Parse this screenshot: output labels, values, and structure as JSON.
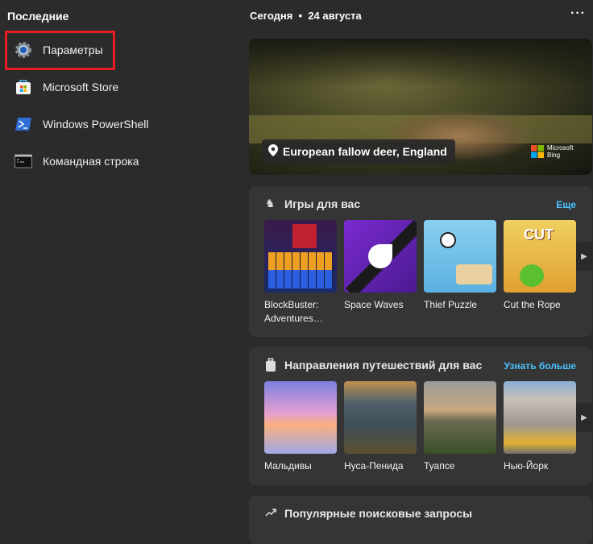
{
  "left": {
    "title": "Последние",
    "items": [
      {
        "label": "Параметры",
        "icon": "settings-gear-icon"
      },
      {
        "label": "Microsoft Store",
        "icon": "microsoft-store-icon"
      },
      {
        "label": "Windows PowerShell",
        "icon": "powershell-icon"
      },
      {
        "label": "Командная строка",
        "icon": "command-prompt-icon"
      }
    ]
  },
  "right": {
    "today": "Сегодня",
    "date": "24 августа",
    "more_icon": "ellipsis-icon",
    "hero": {
      "caption": "European fallow deer, England",
      "brand": "Microsoft Bing"
    },
    "games": {
      "title": "Игры для вас",
      "more": "Еще",
      "items": [
        "BlockBuster: Adventures…",
        "Space Waves",
        "Thief Puzzle",
        "Cut the Rope"
      ]
    },
    "travel": {
      "title": "Направления путешествий для вас",
      "more": "Узнать больше",
      "items": [
        "Мальдивы",
        "Нуса-Пенида",
        "Туапсе",
        "Нью-Йорк"
      ]
    },
    "trending": {
      "title": "Популярные поисковые запросы"
    }
  },
  "colors": {
    "accent": "#4cc2ff",
    "highlight": "#e81c24"
  }
}
